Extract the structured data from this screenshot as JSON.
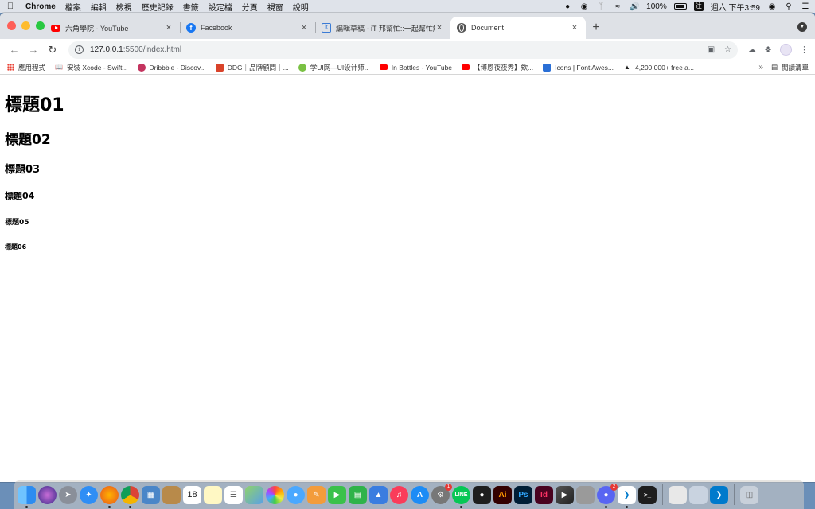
{
  "menubar": {
    "app_name": "Chrome",
    "items": [
      "檔案",
      "編輯",
      "檢視",
      "歷史記錄",
      "書籤",
      "設定檔",
      "分頁",
      "視窗",
      "說明"
    ],
    "battery": "100%",
    "ime_label": "注",
    "clock": "週六 下午3:59"
  },
  "tabs": [
    {
      "title": "六角學院 - YouTube",
      "icon": "youtube-icon"
    },
    {
      "title": "Facebook",
      "icon": "facebook-icon"
    },
    {
      "title": "編輯草稿 - iT 邦幫忙::一起幫忙解決難題",
      "icon": "ithome-icon"
    },
    {
      "title": "Document",
      "icon": "globe-icon",
      "active": true
    }
  ],
  "address": {
    "host": "127.0.0.1",
    "path": ":5500/index.html"
  },
  "bookmarks": [
    {
      "label": "應用程式",
      "icon": "apps-grid-icon"
    },
    {
      "label": "安裝 Xcode - Swift...",
      "icon": "book-icon"
    },
    {
      "label": "Dribbble - Discov...",
      "icon": "dribbble-icon"
    },
    {
      "label": "DDG｜品牌顧問｜...",
      "icon": "ddg-icon"
    },
    {
      "label": "学UI网—UI设计师...",
      "icon": "xueui-icon"
    },
    {
      "label": "In Bottles - YouTube",
      "icon": "youtube-icon"
    },
    {
      "label": "【博恩夜夜秀】欸...",
      "icon": "youtube-icon"
    },
    {
      "label": "Icons | Font Awes...",
      "icon": "fontawesome-icon"
    },
    {
      "label": "4,200,000+ free a...",
      "icon": "freepik-icon"
    }
  ],
  "bookmarks_overflow": "»",
  "reading_list": "閱讀清單",
  "content": {
    "h1": "標題01",
    "h2": "標題02",
    "h3": "標題03",
    "h4": "標題04",
    "h5": "標題05",
    "h6": "標題06"
  },
  "dock": {
    "calendar_day": "18",
    "badges": {
      "settings": "1",
      "discord": "2"
    },
    "labels": {
      "illustrator": "Ai",
      "photoshop": "Ps",
      "indesign": "Id"
    }
  },
  "colors": {
    "youtube": "#ff0000",
    "facebook": "#1877f2",
    "tabstrip": "#dee1e6",
    "omnibox": "#f1f3f4"
  }
}
